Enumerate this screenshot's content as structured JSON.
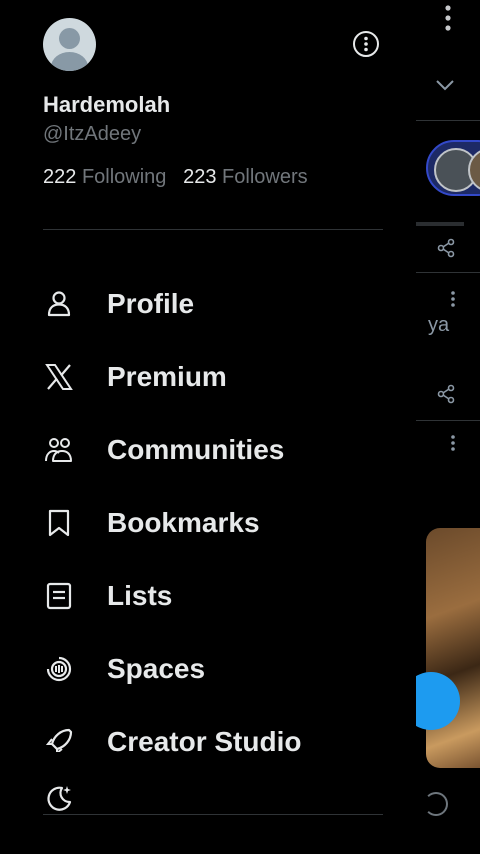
{
  "profile": {
    "name": "Hardemolah",
    "handle": "@ItzAdeey",
    "following_count": "222",
    "following_label": "Following",
    "followers_count": "223",
    "followers_label": "Followers"
  },
  "nav": {
    "items": [
      {
        "label": "Profile",
        "icon": "person-icon"
      },
      {
        "label": "Premium",
        "icon": "x-logo-icon"
      },
      {
        "label": "Communities",
        "icon": "communities-icon"
      },
      {
        "label": "Bookmarks",
        "icon": "bookmark-icon"
      },
      {
        "label": "Lists",
        "icon": "list-icon"
      },
      {
        "label": "Spaces",
        "icon": "spaces-icon"
      },
      {
        "label": "Creator Studio",
        "icon": "rocket-icon"
      }
    ]
  },
  "feed": {
    "snippet_text": "ya"
  },
  "colors": {
    "background": "#000000",
    "text_primary": "#e7e9ea",
    "text_secondary": "#71767b",
    "divider": "#2f3336",
    "accent": "#1d9bf0"
  }
}
